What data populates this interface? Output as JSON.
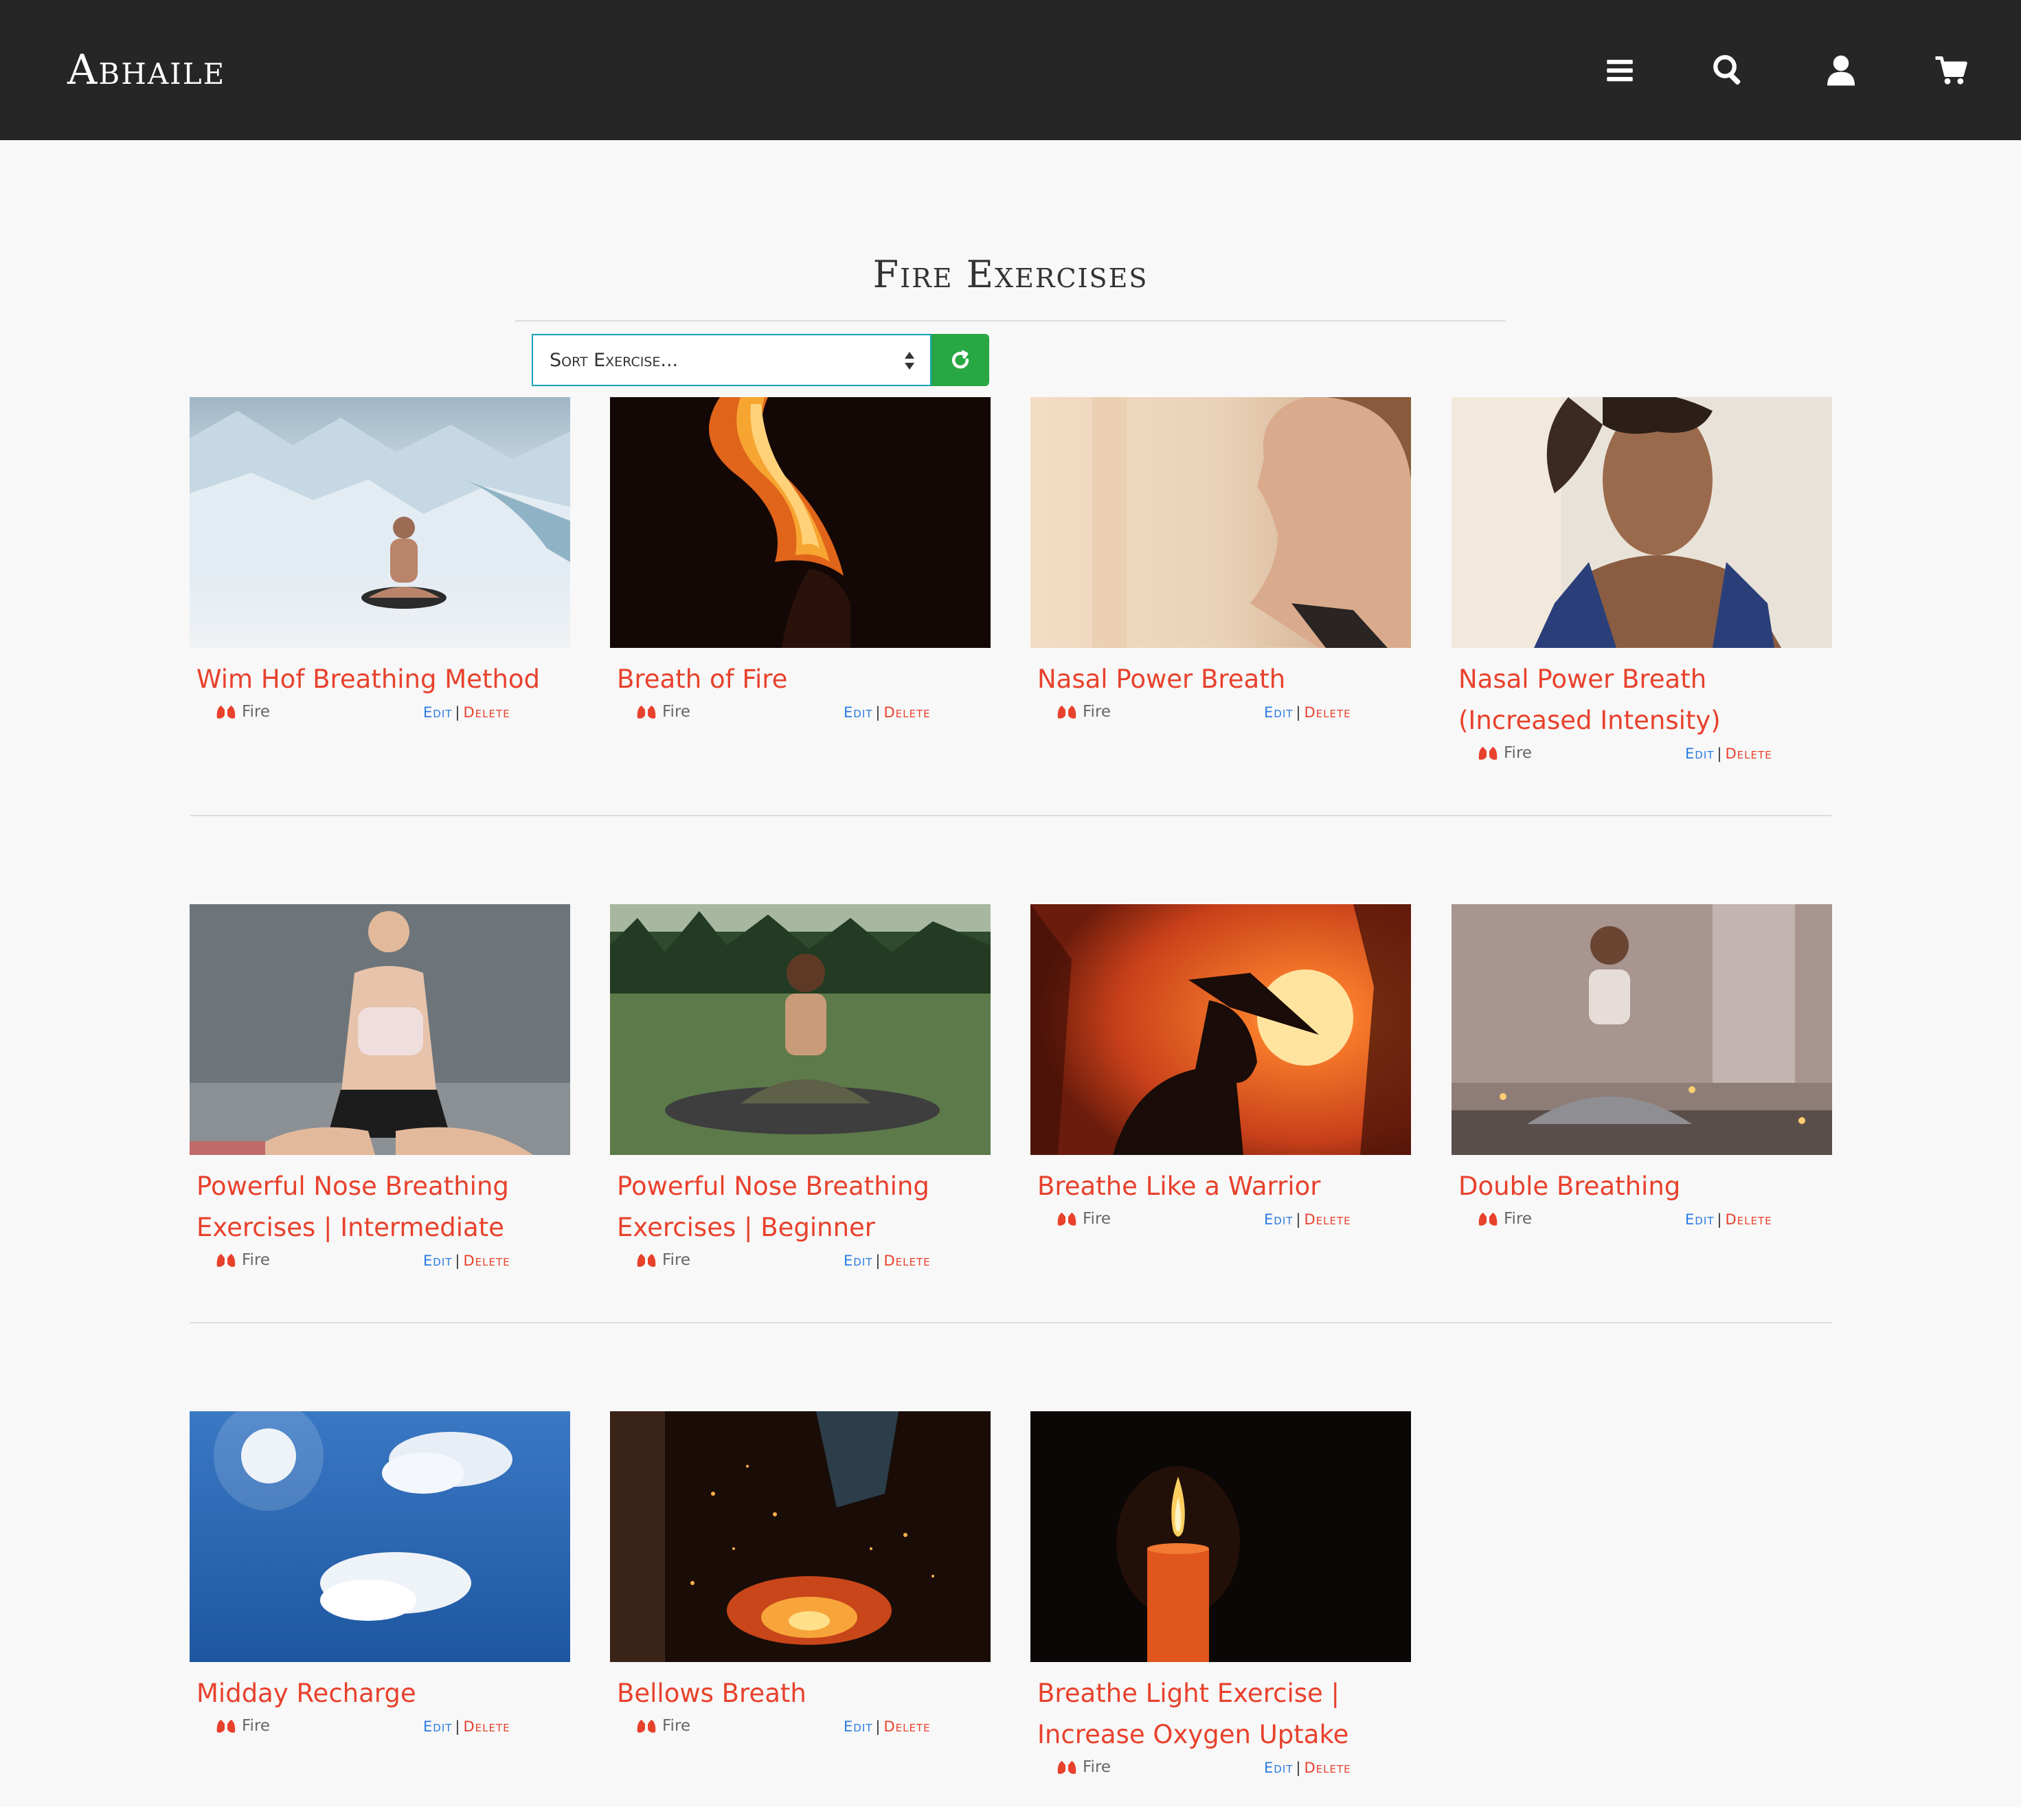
{
  "header": {
    "brand": "Abhaile",
    "icons": [
      "menu-icon",
      "search-icon",
      "user-icon",
      "cart-icon"
    ]
  },
  "page": {
    "title": "Fire Exercises"
  },
  "sort": {
    "selected": "Sort Exercise..."
  },
  "actions": {
    "edit_label": "Edit",
    "separator": "|",
    "delete_label": "Delete"
  },
  "cards": [
    {
      "title": "Wim Hof Breathing Method",
      "category": "Fire"
    },
    {
      "title": "Breath of Fire",
      "category": "Fire"
    },
    {
      "title": "Nasal Power Breath",
      "category": "Fire"
    },
    {
      "title": "Nasal Power Breath (Increased Intensity)",
      "category": "Fire"
    },
    {
      "title": "Powerful Nose Breathing Exercises | Intermediate",
      "category": "Fire"
    },
    {
      "title": "Powerful Nose Breathing Exercises | Beginner",
      "category": "Fire"
    },
    {
      "title": "Breathe Like a Warrior",
      "category": "Fire"
    },
    {
      "title": "Double Breathing",
      "category": "Fire"
    },
    {
      "title": "Midday Recharge",
      "category": "Fire"
    },
    {
      "title": "Bellows Breath",
      "category": "Fire"
    },
    {
      "title": "Breathe Light Exercise | Increase Oxygen Uptake",
      "category": "Fire"
    }
  ],
  "colors": {
    "navbar": "#262626",
    "title_accent": "#e8412c",
    "edit_link": "#2a7ae2",
    "refresh_button": "#28a745",
    "select_border": "#17a2b8"
  }
}
